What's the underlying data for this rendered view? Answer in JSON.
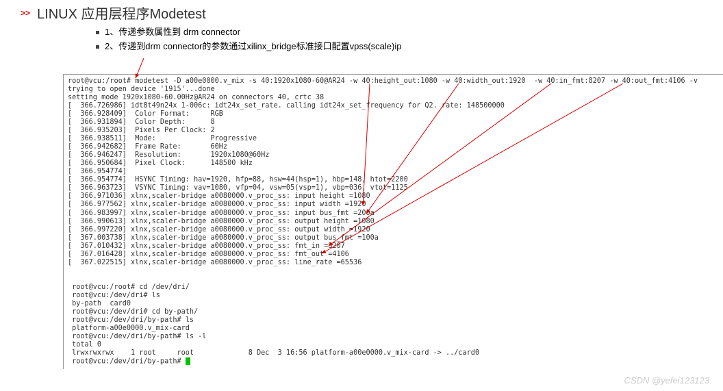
{
  "header": {
    "chevron": ">>",
    "title": "LINUX 应用层程序Modetest",
    "sub1": "1、传递参数属性到 drm connector",
    "sub2": "2、传递到drm connector的参数通过xilinx_bridge标准接口配置vpss(scale)ip"
  },
  "terminal": {
    "lines": [
      "root@vcu:/root# modetest -D a00e0000.v_mix -s 40:1920x1080-60@AR24 -w 40:height_out:1080 -w 40:width_out:1920  -w 40:in_fmt:8207 -w 40:out_fmt:4106 -v",
      "trying to open device '1915'...done",
      "setting mode 1920x1080-60.00Hz@AR24 on connectors 40, crtc 38",
      "[  366.726986] idt8t49n24x 1-006c: idt24x_set_rate. calling idt24x_set_frequency for Q2. rate: 148500000",
      "[  366.928409]  Color Format:     RGB",
      "[  366.931894]  Color Depth:      8",
      "[  366.935203]  Pixels Per Clock: 2",
      "[  366.938511]  Mode:             Progressive",
      "[  366.942682]  Frame Rate:       60Hz",
      "[  366.946247]  Resolution:       1920x1080@60Hz",
      "[  366.950684]  Pixel Clock:      148500 kHz",
      "[  366.954774]",
      "[  366.954774]  HSYNC Timing: hav=1920, hfp=88, hsw=44(hsp=1), hbp=148, htot=2200",
      "[  366.963723]  VSYNC Timing: vav=1080, vfp=04, vsw=05(vsp=1), vbp=036, vtot=1125",
      "[  366.971036] xlnx,scaler-bridge a0080000.v_proc_ss: input height =1080",
      "[  366.977562] xlnx,scaler-bridge a0080000.v_proc_ss: input width =1920",
      "[  366.983997] xlnx,scaler-bridge a0080000.v_proc_ss: input bus_fmt =200a",
      "[  366.990613] xlnx,scaler-bridge a0080000.v_proc_ss: output height =1080",
      "[  366.997220] xlnx,scaler-bridge a0080000.v_proc_ss: output width =1920",
      "[  367.003738] xlnx,scaler-bridge a0080000.v_proc_ss: output bus_fmt =100a",
      "[  367.010432] xlnx,scaler-bridge a0080000.v_proc_ss: fmt_in =8207",
      "[  367.016428] xlnx,scaler-bridge a0080000.v_proc_ss: fmt_out =4106",
      "[  367.022515] xlnx,scaler-bridge a0080000.v_proc_ss: line_rate =65536",
      "",
      "",
      " root@vcu:/root# cd /dev/dri/",
      " root@vcu:/dev/dri# ls",
      " by-path  card0",
      " root@vcu:/dev/dri# cd by-path/",
      " root@vcu:/dev/dri/by-path# ls",
      " platform-a00e0000.v_mix-card",
      " root@vcu:/dev/dri/by-path# ls -l",
      " total 0",
      " lrwxrwxrwx    1 root     root             8 Dec  3 16:56 platform-a00e0000.v_mix-card -> ../card0",
      " root@vcu:/dev/dri/by-path# "
    ]
  },
  "watermark": "CSDN @yefei123123"
}
